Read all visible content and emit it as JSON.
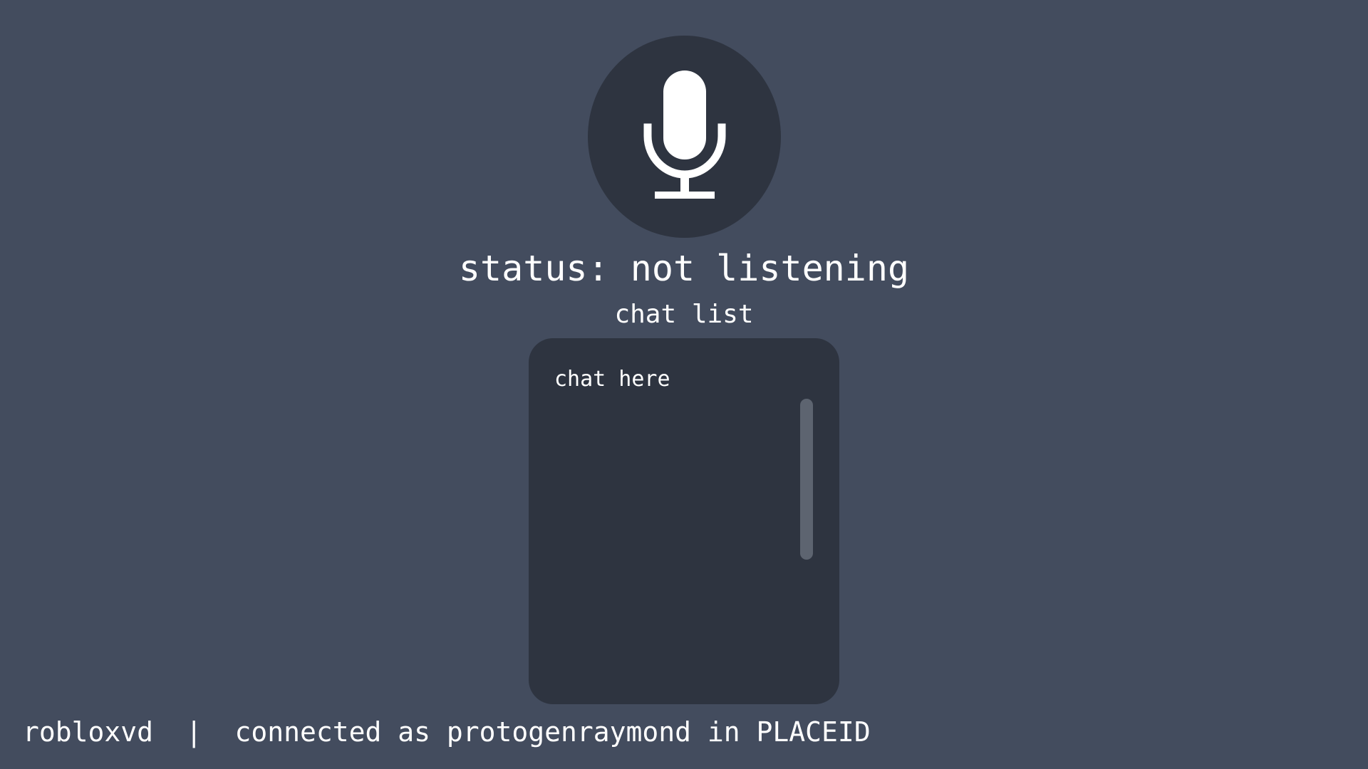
{
  "microphone": {
    "icon": "microphone-icon",
    "colors": {
      "button_background": "#2e3440",
      "icon": "#ffffff"
    }
  },
  "status": {
    "text": "status: not listening"
  },
  "chat": {
    "heading": "chat list",
    "placeholder": "chat here"
  },
  "footer": {
    "app_name": "robloxvd",
    "separator": "|",
    "connection_text": "connected as protogenraymond in PLACEID"
  },
  "colors": {
    "page_background": "#434c5e",
    "panel_background": "#2e3440",
    "scrollbar": "#5d6470",
    "text": "#ffffff"
  }
}
